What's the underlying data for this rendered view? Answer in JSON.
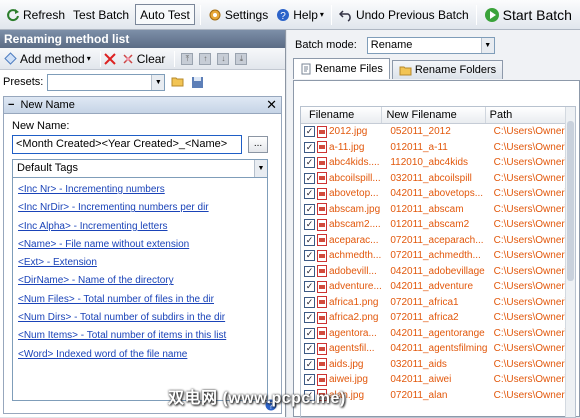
{
  "toolbar": {
    "refresh": "Refresh",
    "test_batch": "Test Batch",
    "auto_test": "Auto Test",
    "settings": "Settings",
    "help": "Help",
    "undo": "Undo Previous Batch",
    "start": "Start Batch"
  },
  "left_panel": {
    "title": "Renaming method list",
    "add_method": "Add method",
    "clear": "Clear",
    "presets_label": "Presets:",
    "presets_value": "",
    "section_title": "New Name",
    "new_name_label": "New Name:",
    "new_name_value": "<Month Created><Year Created>_<Name>",
    "browse": "...",
    "tags_dropdown": "Default Tags",
    "tags": [
      "<Inc Nr> - Incrementing numbers",
      "<Inc NrDir> - Incrementing numbers per dir",
      "<Inc Alpha> - Incrementing letters",
      "<Name> - File name without extension",
      "<Ext> - Extension",
      "<DirName> - Name of the directory",
      "<Num Files> - Total number of files in the dir",
      "<Num Dirs> - Total number of subdirs in the dir",
      "<Num Items> - Total number of items in this list",
      "<Word> Indexed word of the file name"
    ]
  },
  "right_panel": {
    "batch_mode_label": "Batch mode:",
    "batch_mode_value": "Rename",
    "tabs": [
      "Rename Files",
      "Rename Folders"
    ],
    "columns": [
      "Filename",
      "New Filename",
      "Path"
    ],
    "files": [
      {
        "name": "2012.jpg",
        "new": "052011_2012",
        "path": "C:\\Users\\Owner\\"
      },
      {
        "name": "a-11.jpg",
        "new": "012011_a-11",
        "path": "C:\\Users\\Owner\\"
      },
      {
        "name": "abc4kids....",
        "new": "112010_abc4kids",
        "path": "C:\\Users\\Owner\\"
      },
      {
        "name": "abcoilspill...",
        "new": "032011_abcoilspill",
        "path": "C:\\Users\\Owner\\"
      },
      {
        "name": "abovetop...",
        "new": "042011_abovetops...",
        "path": "C:\\Users\\Owner\\"
      },
      {
        "name": "abscam.jpg",
        "new": "012011_abscam",
        "path": "C:\\Users\\Owner\\"
      },
      {
        "name": "abscam2....",
        "new": "012011_abscam2",
        "path": "C:\\Users\\Owner\\"
      },
      {
        "name": "aceparac...",
        "new": "072011_aceparach...",
        "path": "C:\\Users\\Owner\\"
      },
      {
        "name": "achmedth...",
        "new": "072011_achmedth...",
        "path": "C:\\Users\\Owner\\"
      },
      {
        "name": "adobevill...",
        "new": "042011_adobevillage",
        "path": "C:\\Users\\Owner\\"
      },
      {
        "name": "adventure...",
        "new": "042011_adventure",
        "path": "C:\\Users\\Owner\\"
      },
      {
        "name": "africa1.png",
        "new": "072011_africa1",
        "path": "C:\\Users\\Owner\\"
      },
      {
        "name": "africa2.png",
        "new": "072011_africa2",
        "path": "C:\\Users\\Owner\\"
      },
      {
        "name": "agentora...",
        "new": "042011_agentorange",
        "path": "C:\\Users\\Owner\\"
      },
      {
        "name": "agentsfil...",
        "new": "042011_agentsfilming",
        "path": "C:\\Users\\Owner\\"
      },
      {
        "name": "aids.jpg",
        "new": "032011_aids",
        "path": "C:\\Users\\Owner\\"
      },
      {
        "name": "aiwei.jpg",
        "new": "042011_aiwei",
        "path": "C:\\Users\\Owner\\"
      },
      {
        "name": "alan.jpg",
        "new": "072011_alan",
        "path": "C:\\Users\\Owner\\"
      }
    ]
  },
  "watermark": "双电网 (www.pcpc.me)"
}
